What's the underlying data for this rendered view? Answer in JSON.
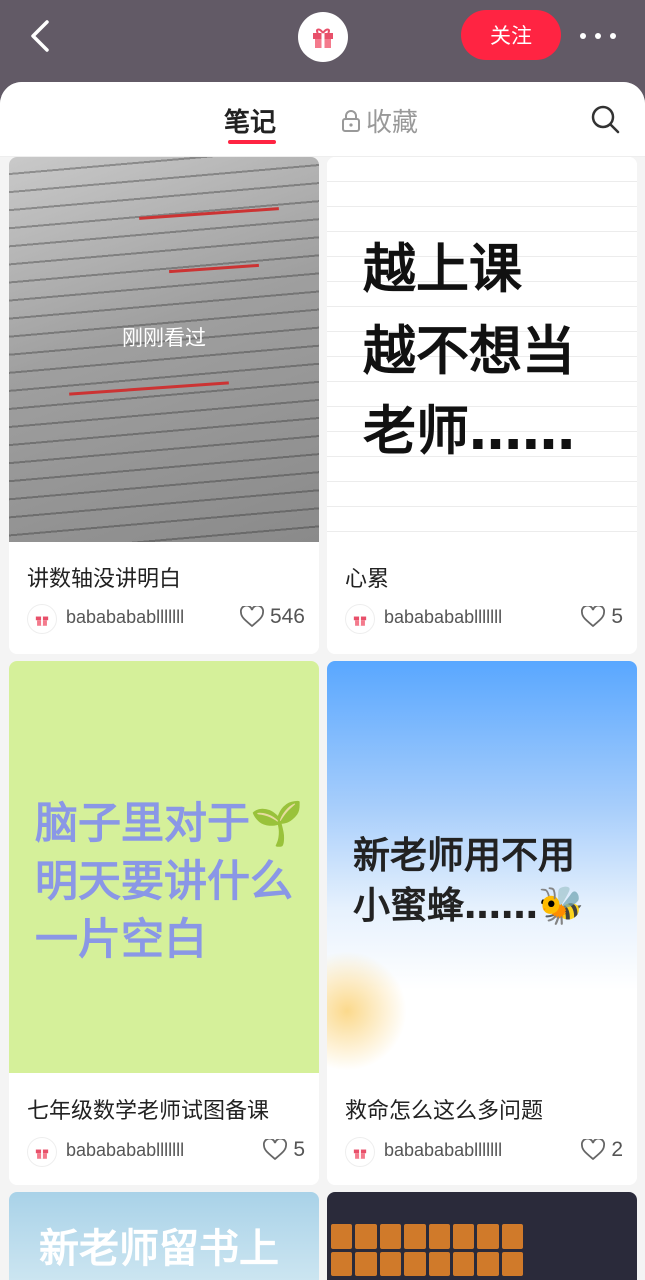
{
  "header": {
    "follow_label": "关注",
    "avatar_icon": "gift-icon"
  },
  "tabs": {
    "notes": "笔记",
    "favorites": "收藏"
  },
  "colors": {
    "accent": "#ff2442",
    "header_bg": "#625a66"
  },
  "cards": [
    {
      "image_overlay": "刚刚看过",
      "title": "讲数轴没讲明白",
      "author": "babababablllllll",
      "likes": "546"
    },
    {
      "image_text": [
        "越上课",
        "越不想当",
        "老师……"
      ],
      "title": "心累",
      "author": "babababablllllll",
      "likes": "5"
    },
    {
      "image_text": [
        "脑子里对于🌱",
        "明天要讲什么",
        "一片空白"
      ],
      "title": "七年级数学老师试图备课",
      "author": "babababablllllll",
      "likes": "5"
    },
    {
      "image_text": [
        "新老师用不用",
        "小蜜蜂……🐝"
      ],
      "title": "救命怎么这么多问题",
      "author": "babababablllllll",
      "likes": "2"
    },
    {
      "image_text": [
        "新老师留书上"
      ]
    },
    {}
  ]
}
